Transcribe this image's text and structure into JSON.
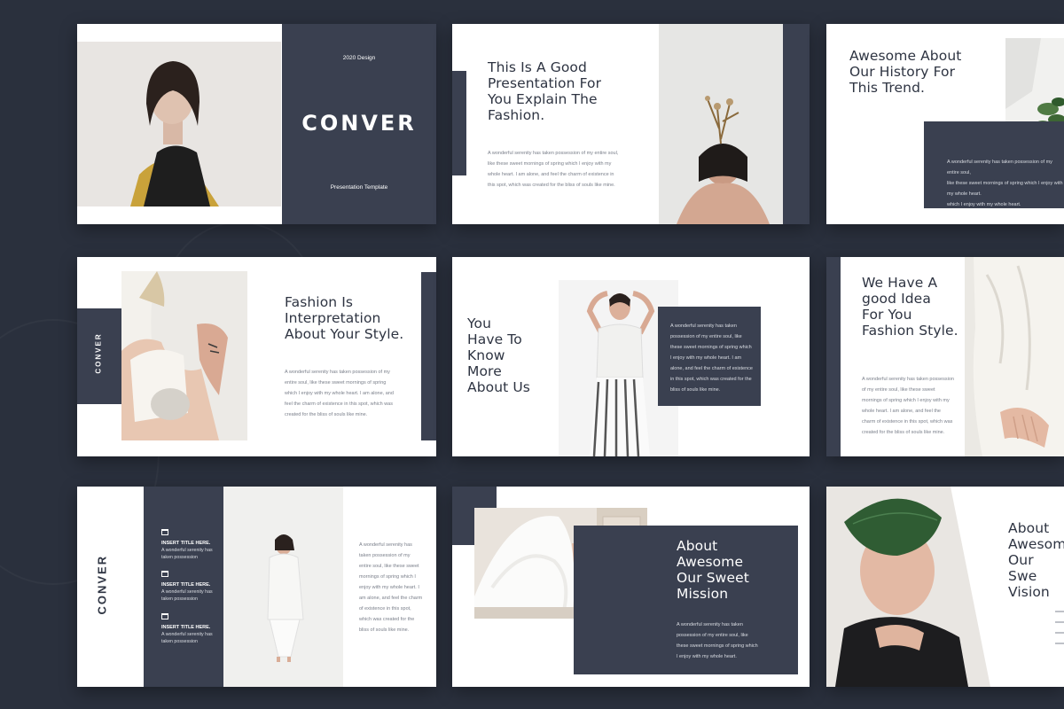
{
  "slide1": {
    "tag": "2020 Design",
    "title": "CONVER",
    "subtitle": "Presentation Template"
  },
  "slide2": {
    "heading": [
      "This Is A Good",
      "Presentation For",
      "You Explain The",
      "Fashion."
    ],
    "body": [
      "A wonderful serenity has taken possession of my entire soul,",
      "like these sweet mornings of spring which I enjoy with my",
      "whole heart. I am alone, and feel the charm of existence in",
      "this spot, which was created for the bliss of souls like mine."
    ]
  },
  "slide3": {
    "heading": [
      "Awesome About",
      "Our History For",
      "This Trend."
    ],
    "body": [
      "A wonderful serenity has taken possession of my entire soul,",
      "like these sweet mornings of spring which I enjoy with my whole heart.",
      "which I enjoy with my whole heart."
    ]
  },
  "slide4": {
    "brand": "CONVER",
    "heading": [
      "Fashion Is",
      "Interpretation",
      "About Your Style."
    ],
    "body": [
      "A wonderful serenity has taken possession of my",
      "entire soul, like these sweet mornings of spring",
      "which I enjoy with my whole heart. I am alone, and",
      "feel the charm of existence in this spot, which was",
      "created for the bliss of souls like mine."
    ]
  },
  "slide5": {
    "heading": [
      "You",
      "Have To",
      "Know",
      "More",
      "About Us"
    ],
    "body": [
      "A wonderful serenity has taken",
      "possession of my entire soul, like",
      "these sweet mornings of spring which",
      "I enjoy with my whole heart. I am",
      "alone, and feel the charm of existence",
      "in this spot, which was created for the",
      "bliss of souls like mine."
    ]
  },
  "slide6": {
    "heading": [
      "We Have A",
      "good Idea",
      "For You",
      "Fashion Style."
    ],
    "body": [
      "A wonderful serenity has taken possession",
      "of my entire soul, like these sweet",
      "mornings of spring which I enjoy with my",
      "whole heart. I am alone, and feel the",
      "charm of existence in this spot, which was",
      "created for the bliss of souls like mine."
    ]
  },
  "slide7": {
    "brand": "CONVER",
    "items": [
      {
        "title": "INSERT TITLE HERE.",
        "line1": "A wonderful serenity has",
        "line2": "taken possession"
      },
      {
        "title": "INSERT TITLE HERE.",
        "line1": "A wonderful serenity has",
        "line2": "taken possession"
      },
      {
        "title": "INSERT TITLE HERE.",
        "line1": "A wonderful serenity has",
        "line2": "taken possession"
      }
    ],
    "body": [
      "A wonderful serenity has",
      "taken possession of my",
      "entire soul, like these sweet",
      "mornings of spring which I",
      "enjoy with my whole heart. I",
      "am alone, and feel the charm",
      "of existence in this spot,",
      "which was created for the",
      "bliss of souls like mine."
    ]
  },
  "slide8": {
    "heading": [
      "About",
      "Awesome",
      "Our Sweet",
      "Mission"
    ],
    "body": [
      "A wonderful serenity has taken",
      "possession of my entire soul, like",
      "these sweet mornings of spring which",
      "I enjoy with my whole heart."
    ]
  },
  "slide9": {
    "heading": [
      "About",
      "Awesom",
      "Our Swe",
      "Vision"
    ]
  },
  "colors": {
    "background": "#2a303d",
    "navy": "#3a4050",
    "slide": "#ffffff",
    "heading": "#2e3442"
  }
}
